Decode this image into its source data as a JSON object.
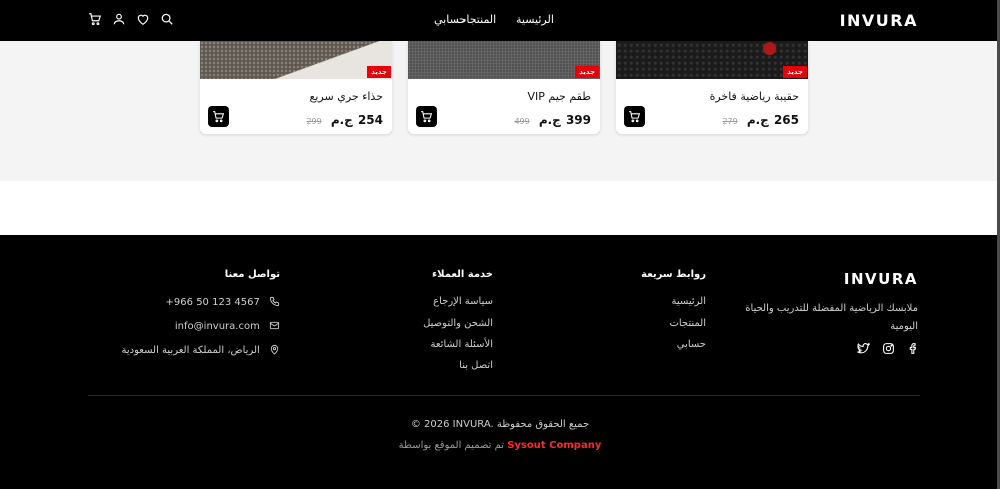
{
  "header": {
    "logo": "INVURA",
    "nav": {
      "home": "الرئيسية",
      "products": "المنتجات",
      "account": "حسابي"
    },
    "icons": [
      "search-icon",
      "heart-icon",
      "user-icon",
      "cart-icon"
    ]
  },
  "products": [
    {
      "name": "حقيبة رياضية فاخرة",
      "price": "265",
      "old_price": "279",
      "currency": "ج.م",
      "badge": "جديد"
    },
    {
      "name": "طقم جيم VIP",
      "price": "399",
      "old_price": "499",
      "currency": "ج.م",
      "badge": "جديد"
    },
    {
      "name": "حذاء جري سريع",
      "price": "254",
      "old_price": "299",
      "currency": "ج.م",
      "badge": "جديد"
    }
  ],
  "footer": {
    "logo": "INVURA",
    "description": "ملابسك الرياضية المفضلة للتدريب والحياة اليومية",
    "quick_links": {
      "title": "روابط سريعة",
      "items": [
        "الرئيسية",
        "المنتجات",
        "حسابي"
      ]
    },
    "customer_service": {
      "title": "خدمة العملاء",
      "items": [
        "سياسة الإرجاع",
        "الشحن والتوصيل",
        "الأسئلة الشائعة",
        "اتصل بنا"
      ]
    },
    "contact": {
      "title": "تواصل معنا",
      "phone": "+966 50 123 4567",
      "email": "info@invura.com",
      "address": "الرياض، المملكة العربية السعودية"
    },
    "copyright": "© 2026 INVURA. جميع الحقوق محفوظة",
    "credit_prefix": "تم تصميم الموقع بواسطة",
    "credit_company": "Sysout Company"
  },
  "colors": {
    "accent": "#e5000a",
    "dark": "#000000"
  }
}
